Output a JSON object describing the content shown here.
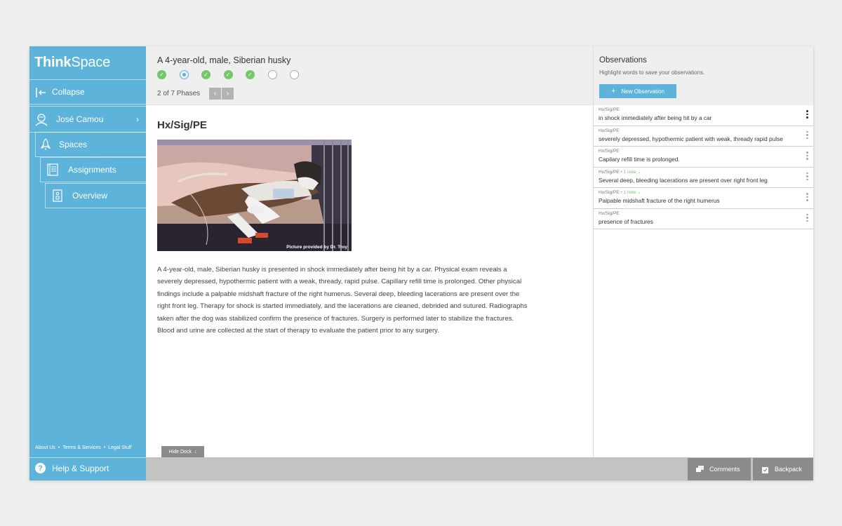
{
  "app": {
    "logo_bold": "Think",
    "logo_light": "Space"
  },
  "sidebar": {
    "collapse": "Collapse",
    "user": "José Camou",
    "spaces": "Spaces",
    "assignments": "Assignments",
    "overview": "Overview",
    "footer": {
      "about": "About Us",
      "terms": "Terms & Services",
      "legal": "Legal Stuff",
      "sep": "•"
    },
    "help": "Help & Support"
  },
  "header": {
    "case_title": "A 4-year-old, male, Siberian husky",
    "phase_count": "2 of  7  Phases",
    "phases": [
      "done",
      "current",
      "done",
      "done",
      "done",
      "todo",
      "todo"
    ]
  },
  "content": {
    "section_title": "Hx/Sig/PE",
    "photo_credit": "Picture provided by Dr. Troy",
    "body": "A 4-year-old, male, Siberian husky is presented in shock immediately after being hit by a car. Physical exam reveals a severely depressed, hypothermic patient with a weak, thready, rapid pulse. Capillary refill time is prolonged. Other physical findings include a palpable midshaft fracture of the right humerus. Several deep, bleeding lacerations are present over the right front leg. Therapy for shock is started immediately, and the lacerations are cleaned, debrided and sutured. Radiographs taken after the dog was stabilized confirm the presence of fractures. Surgery is performed later to stabilize the fractures. Blood and urine are collected at the start of therapy to evaluate the patient prior to any surgery.",
    "hide_dock": "Hide Dock"
  },
  "bottom": {
    "comments": "Comments",
    "backpack": "Backpack"
  },
  "observations": {
    "title": "Observations",
    "subtitle": "Highlight words to save your observations.",
    "new_button": "New Observation",
    "items": [
      {
        "phase": "Hx/Sig/PE",
        "note": "",
        "text": "in shock immediately after being hit by a car"
      },
      {
        "phase": "Hx/Sig/PE",
        "note": "",
        "text": "severely depressed, hypothermic patient with weak, thready rapid pulse"
      },
      {
        "phase": "Hx/Sig/PE",
        "note": "",
        "text": "Capilary refill time is prolonged."
      },
      {
        "phase": "Hx/Sig/PE",
        "note": "• 1 note ⌄",
        "text": "Several deep, bleeding lacerations are present over right front leg"
      },
      {
        "phase": "Hx/Sig/PE",
        "note": "• 1 note ⌄",
        "text": "Palpable midshaft fracture of the right humerus"
      },
      {
        "phase": "Hx/Sig/PE",
        "note": "",
        "text": "presence of fractures"
      }
    ]
  },
  "colors": {
    "accent": "#5db3d9",
    "done": "#74c76a",
    "dock": "#8b8b8b"
  }
}
